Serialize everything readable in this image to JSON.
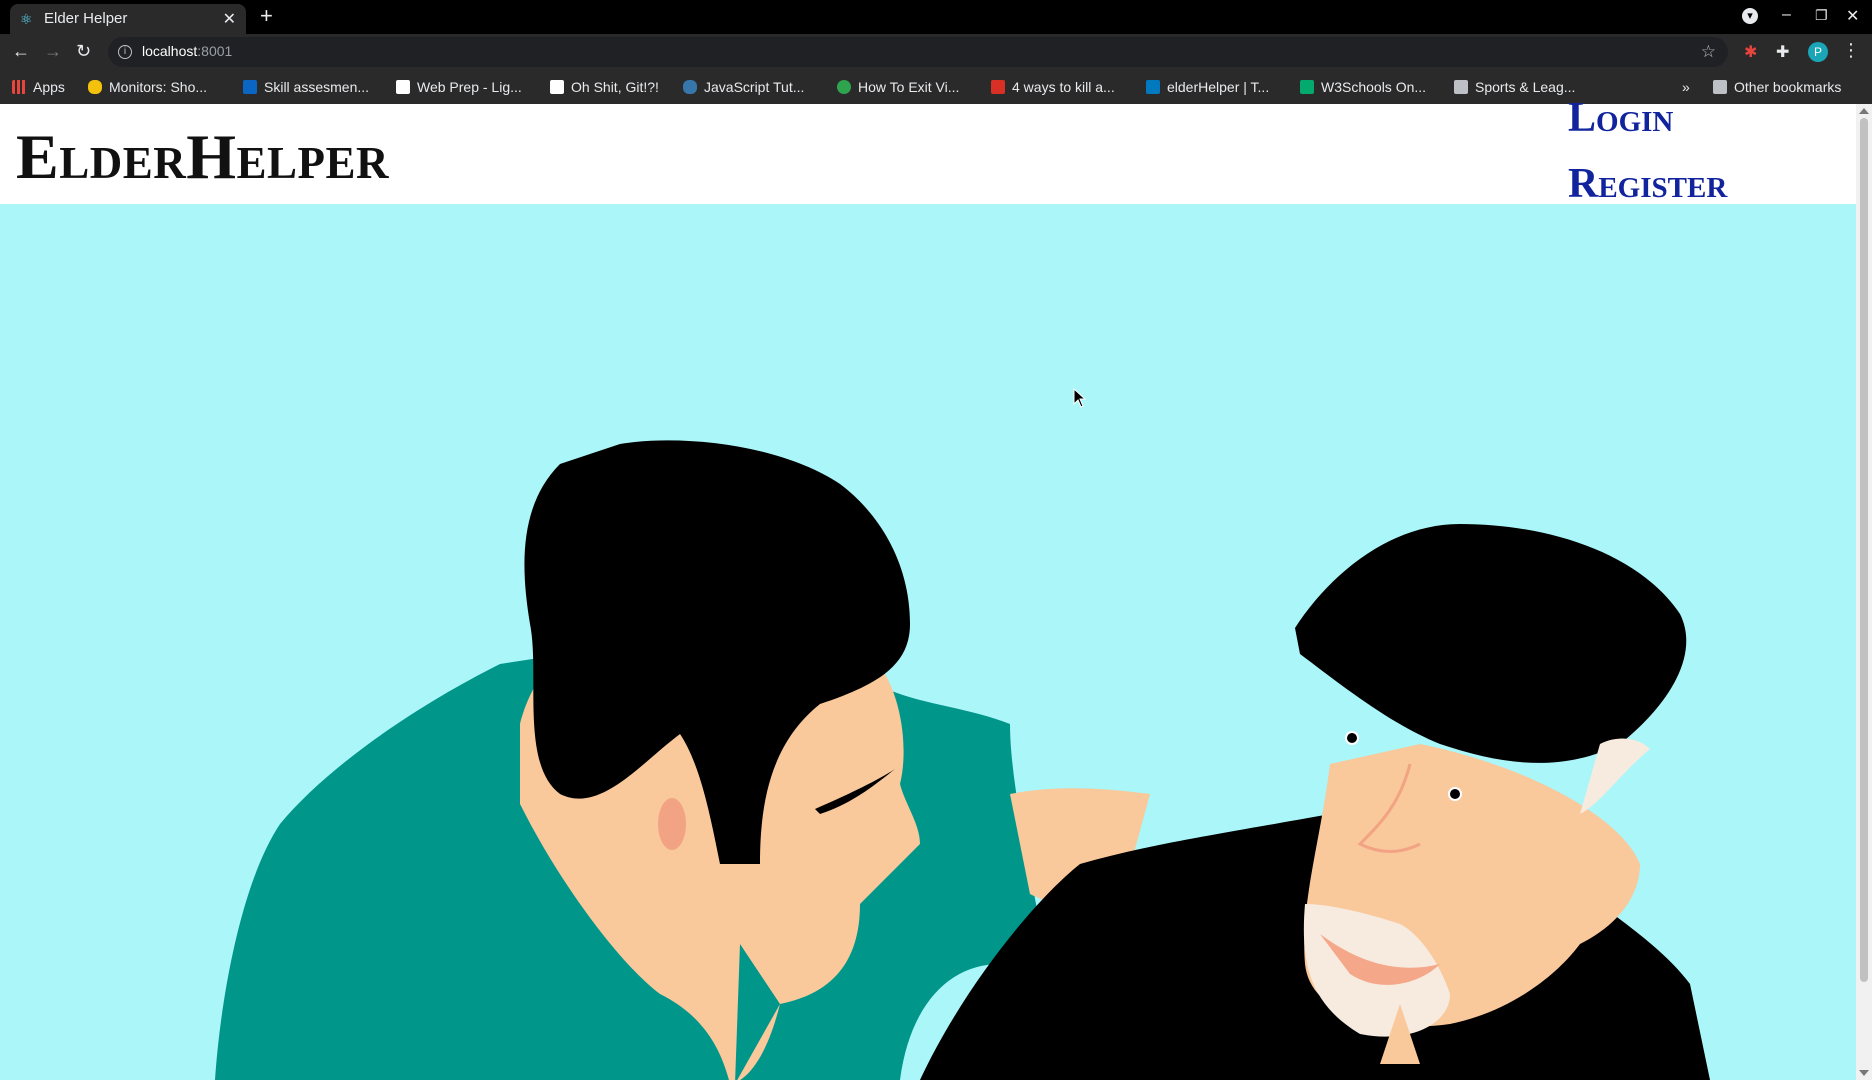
{
  "browser": {
    "tab_title": "Elder Helper",
    "url_host": "localhost",
    "url_port": ":8001",
    "bookmarks": [
      {
        "label": "Apps",
        "color": "#e8453c"
      },
      {
        "label": "Monitors: Sho...",
        "color": "#f4c20d"
      },
      {
        "label": "Skill assesmen...",
        "color": "#0a66c2"
      },
      {
        "label": "Web Prep - Lig...",
        "color": "#ffffff"
      },
      {
        "label": "Oh Shit, Git!?!",
        "color": "#ffffff"
      },
      {
        "label": "JavaScript Tut...",
        "color": "#3776ab"
      },
      {
        "label": "How To Exit Vi...",
        "color": "#2ea44f"
      },
      {
        "label": "4 ways to kill a...",
        "color": "#d93025"
      },
      {
        "label": "elderHelper | T...",
        "color": "#0079bf"
      },
      {
        "label": "W3Schools On...",
        "color": "#04aa6d"
      },
      {
        "label": "Sports & Leag...",
        "color": "#bdc1c6"
      }
    ],
    "other_bookmarks": "Other bookmarks",
    "avatar_letter": "P"
  },
  "header": {
    "brand": "ElderHelper",
    "login_label": "Login",
    "register_label": "Register"
  },
  "colors": {
    "hero_background": "#aaf6f9",
    "nav_link": "#12239e",
    "caregiver_shirt": "#00968a",
    "skin": "#f9c89b",
    "hair": "#000000"
  }
}
